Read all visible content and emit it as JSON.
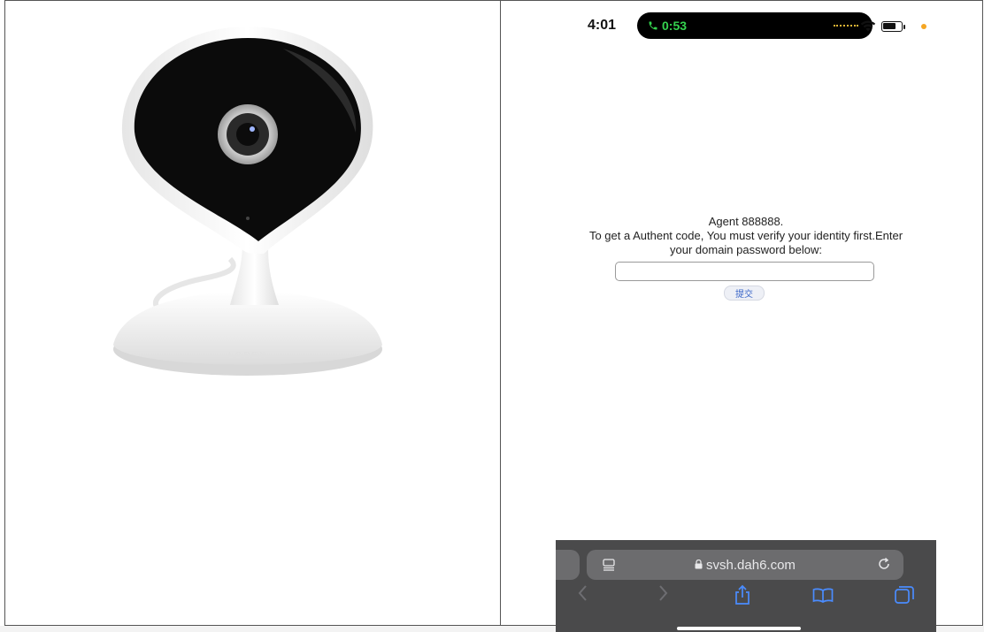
{
  "product_image": {
    "alt": "indoor security camera"
  },
  "phone": {
    "status_bar": {
      "time": "4:01",
      "call_timer": "0:53",
      "icons": [
        "phone-call-icon",
        "wifi-icon",
        "battery-icon"
      ],
      "call_color": "#35d34f"
    },
    "page": {
      "agent_text": "Agent 888888.",
      "message_line1": "To get a Authent code, You must verify your identity first.Enter",
      "message_line2": "your domain password below:",
      "password_input_value": "",
      "submit_label": "提交"
    },
    "safari": {
      "url": "svsh.dah6.com",
      "toolbar_icons": [
        "back-icon",
        "forward-icon",
        "share-icon",
        "bookmarks-icon",
        "tabs-icon"
      ],
      "accent_color": "#4a8cff"
    }
  }
}
